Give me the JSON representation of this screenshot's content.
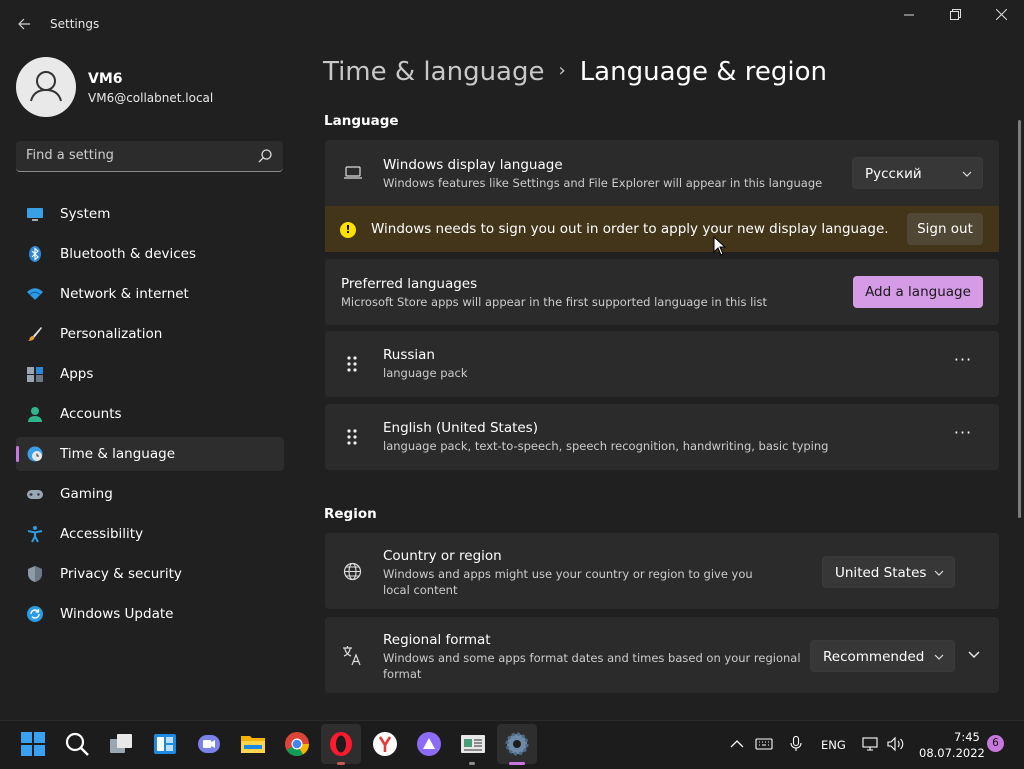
{
  "window": {
    "title": "Settings",
    "back_icon": "arrow-left-icon",
    "minimize_icon": "minimize-icon",
    "maximize_icon": "restore-icon",
    "close_icon": "close-icon"
  },
  "user": {
    "name": "VM6",
    "email": "VM6@collabnet.local"
  },
  "search": {
    "placeholder": "Find a setting"
  },
  "sidebar": {
    "items": [
      {
        "label": "System",
        "icon": "system-icon",
        "selected": false
      },
      {
        "label": "Bluetooth & devices",
        "icon": "bluetooth-icon",
        "selected": false
      },
      {
        "label": "Network & internet",
        "icon": "wifi-icon",
        "selected": false
      },
      {
        "label": "Personalization",
        "icon": "brush-icon",
        "selected": false
      },
      {
        "label": "Apps",
        "icon": "apps-icon",
        "selected": false
      },
      {
        "label": "Accounts",
        "icon": "accounts-icon",
        "selected": false
      },
      {
        "label": "Time & language",
        "icon": "globe-clock-icon",
        "selected": true
      },
      {
        "label": "Gaming",
        "icon": "gamepad-icon",
        "selected": false
      },
      {
        "label": "Accessibility",
        "icon": "accessibility-icon",
        "selected": false
      },
      {
        "label": "Privacy & security",
        "icon": "shield-icon",
        "selected": false
      },
      {
        "label": "Windows Update",
        "icon": "update-icon",
        "selected": false
      }
    ],
    "accent_color": "#c678dd"
  },
  "breadcrumb": {
    "parent": "Time & language",
    "separator": "›",
    "current": "Language & region"
  },
  "language_section": {
    "title": "Language",
    "display_language": {
      "title": "Windows display language",
      "description": "Windows features like Settings and File Explorer will appear in this language",
      "value": "Русский"
    },
    "warning": {
      "text": "Windows needs to sign you out in order to apply your new display language.",
      "button": "Sign out"
    },
    "preferred": {
      "title": "Preferred languages",
      "description": "Microsoft Store apps will appear in the first supported language in this list",
      "add_button": "Add a language"
    },
    "languages": [
      {
        "name": "Russian",
        "features": "language pack"
      },
      {
        "name": "English (United States)",
        "features": "language pack, text-to-speech, speech recognition, handwriting, basic typing"
      }
    ]
  },
  "region_section": {
    "title": "Region",
    "country": {
      "title": "Country or region",
      "description": "Windows and apps might use your country or region to give you local content",
      "value": "United States"
    },
    "format": {
      "title": "Regional format",
      "description": "Windows and some apps format dates and times based on your regional format",
      "value": "Recommended"
    }
  },
  "taskbar": {
    "apps": [
      "start-icon",
      "search-icon",
      "task-view-icon",
      "widgets-icon",
      "teams-chat-icon",
      "file-explorer-icon",
      "chrome-icon",
      "opera-icon",
      "yandex-browser-icon",
      "alice-icon",
      "news-app-icon",
      "settings-icon"
    ],
    "tray": {
      "language": "ENG",
      "time": "7:45",
      "date": "08.07.2022",
      "notifications": "6"
    }
  }
}
